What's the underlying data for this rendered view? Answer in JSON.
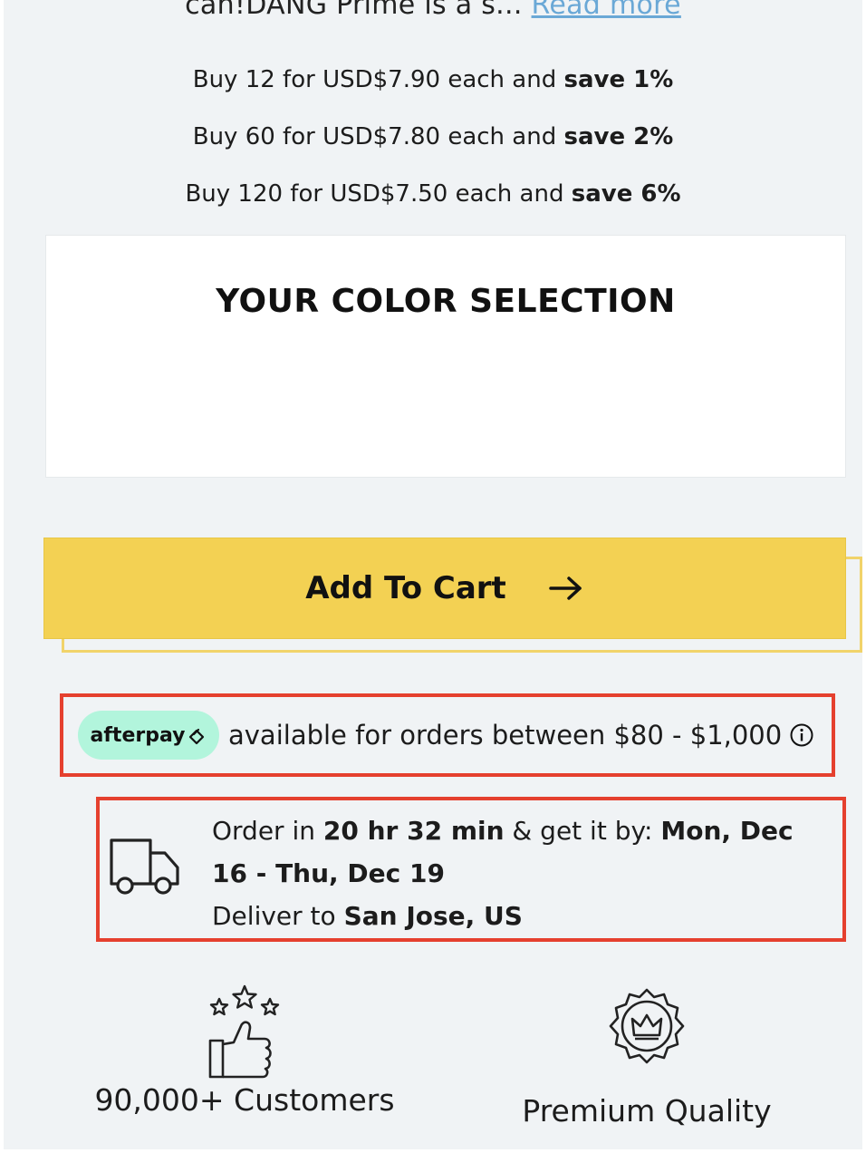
{
  "description": {
    "text": "can!DANG Prime is a s...",
    "read_more": "Read more"
  },
  "tiers": [
    {
      "prefix": "Buy 12 for USD$7.90 each and ",
      "save": "save 1%"
    },
    {
      "prefix": "Buy 60 for USD$7.80 each and ",
      "save": "save 2%"
    },
    {
      "prefix": "Buy 120 for USD$7.50 each and ",
      "save": "save 6%"
    }
  ],
  "color_selection": {
    "title": "YOUR COLOR SELECTION"
  },
  "cart": {
    "label": "Add To Cart",
    "icon": "arrow-right-icon",
    "color": "#f3d153"
  },
  "afterpay": {
    "badge": "afterpay",
    "text": "available for orders between $80 - $1,000",
    "badge_color": "#b2f5dc",
    "info_icon": "info-icon"
  },
  "delivery": {
    "order_in_prefix": "Order in ",
    "countdown": "20 hr 32 min",
    "get_it_by": " & get it by: ",
    "date_range": "Mon, Dec 16 - Thu, Dec 19",
    "deliver_to_prefix": "Deliver to ",
    "location": "San Jose, US",
    "icon": "truck-icon"
  },
  "features": [
    {
      "label": "90,000+ Customers",
      "icon": "thumbs-up-stars-icon"
    },
    {
      "label": "Premium Quality",
      "icon": "crown-badge-icon"
    }
  ],
  "colors": {
    "highlight_border": "#e5402e",
    "link": "#6aa8d6",
    "background": "#f0f3f5"
  }
}
